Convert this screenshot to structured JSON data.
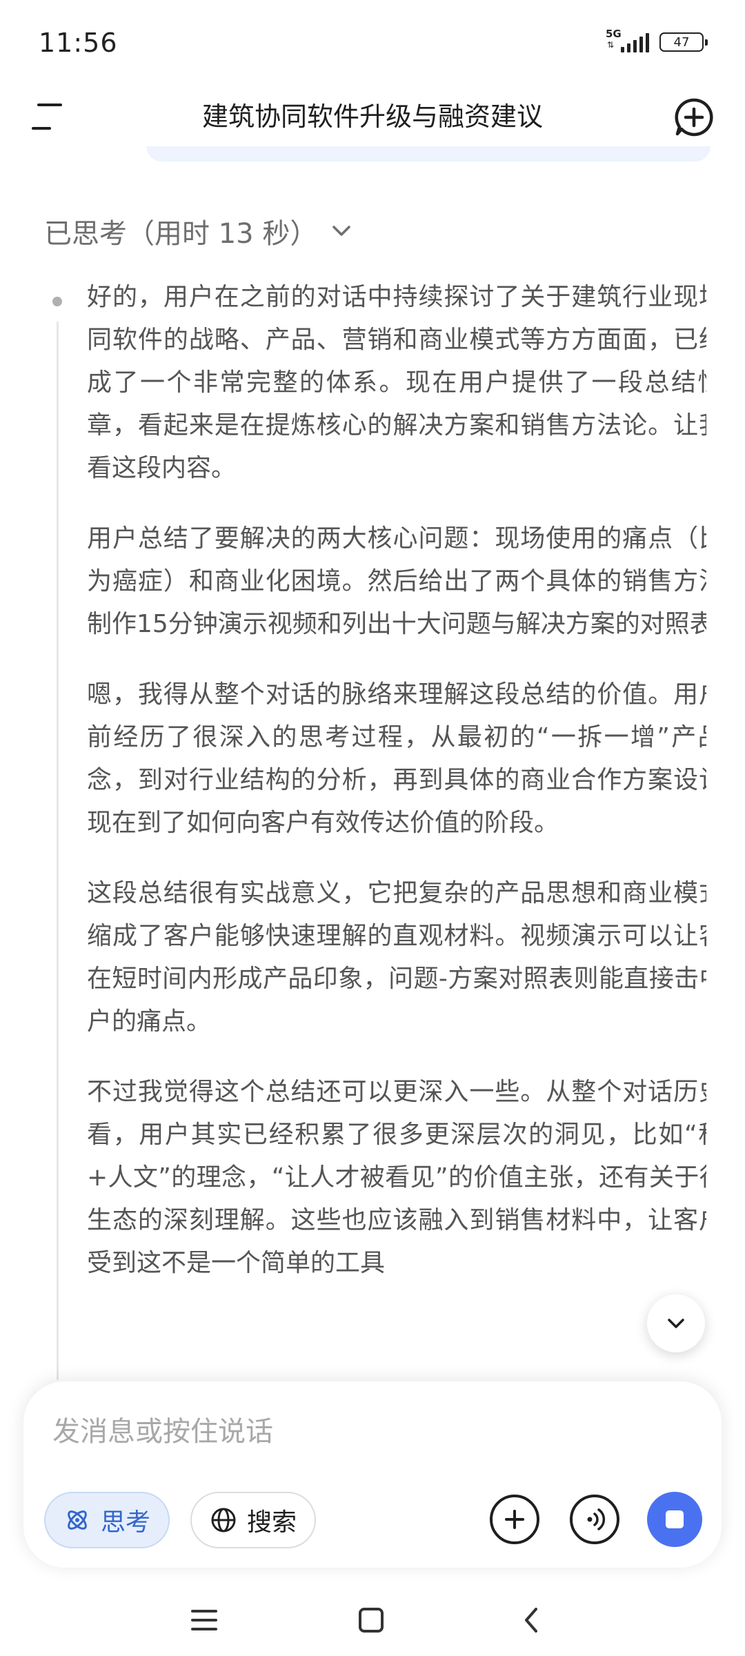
{
  "status": {
    "time": "11:56",
    "network": "5G",
    "battery": "47"
  },
  "header": {
    "title": "建筑协同软件升级与融资建议"
  },
  "thinking": {
    "label": "已思考（用时 13 秒）",
    "paragraphs": [
      "好的，用户在之前的对话中持续探讨了关于建筑行业现场协同软件的战略、产品、营销和商业模式等方方面面，已经形成了一个非常完整的体系。现在用户提供了一段总结性文章，看起来是在提炼核心的解决方案和销售方法论。让我看看这段内容。",
      "用户总结了要解决的两大核心问题：现场使用的痛点（比喻为癌症）和商业化困境。然后给出了两个具体的销售方法：制作15分钟演示视频和列出十大问题与解决方案的对照表。",
      "嗯，我得从整个对话的脉络来理解这段总结的价值。用户之前经历了很深入的思考过程，从最初的“一拆一增”产品理念，到对行业结构的分析，再到具体的商业合作方案设计，现在到了如何向客户有效传达价值的阶段。",
      "这段总结很有实战意义，它把复杂的产品思想和商业模式浓缩成了客户能够快速理解的直观材料。视频演示可以让客户在短时间内形成产品印象，问题-方案对照表则能直接击中客户的痛点。",
      "不过我觉得这个总结还可以更深入一些。从整个对话历史来看，用户其实已经积累了很多更深层次的洞见，比如“科技+人文”的理念，“让人才被看见”的价值主张，还有关于行业生态的深刻理解。这些也应该融入到销售材料中，让客户感受到这不是一个简单的工具"
    ]
  },
  "composer": {
    "placeholder": "发消息或按住说话",
    "think_label": "思考",
    "search_label": "搜索"
  },
  "colors": {
    "accent": "#4a72f0",
    "think_chip_bg": "#e6eefc",
    "think_chip_text": "#3366cc"
  }
}
